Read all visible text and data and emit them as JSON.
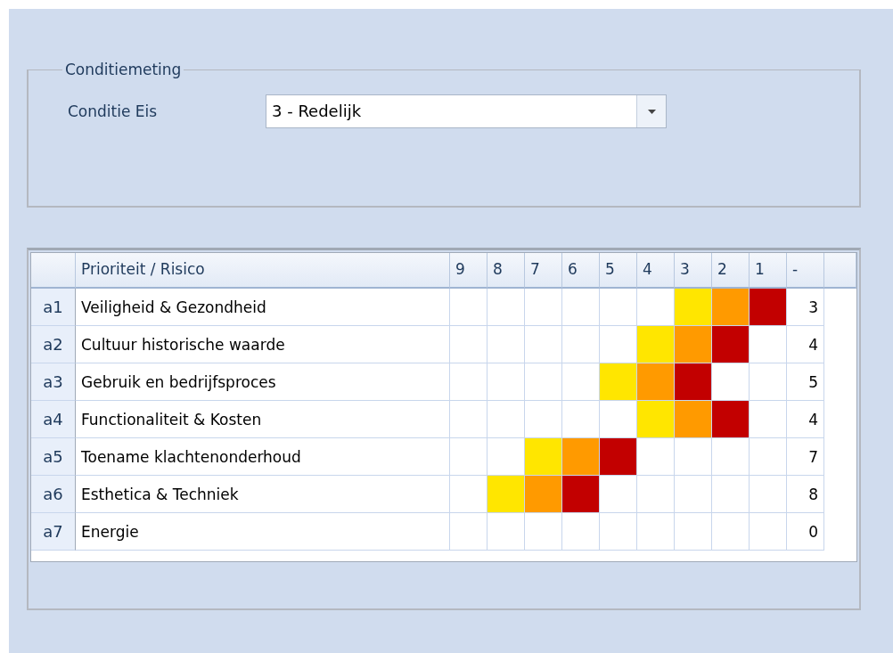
{
  "group": {
    "title": "Conditiemeting",
    "label": "Conditie Eis",
    "dropdown": {
      "value": "3 - Redelijk"
    }
  },
  "table": {
    "columns": [
      "Prioriteit / Risico",
      "9",
      "8",
      "7",
      "6",
      "5",
      "4",
      "3",
      "2",
      "1",
      "-"
    ],
    "rows": [
      {
        "code": "a1",
        "name": "Veiligheid & Gezondheid",
        "cells": [
          {
            "filled": false
          },
          {
            "filled": false
          },
          {
            "filled": false
          },
          {
            "filled": false
          },
          {
            "filled": false
          },
          {
            "filled": false
          },
          {
            "filled": true,
            "color": "#ffe600"
          },
          {
            "filled": true,
            "color": "#ff9a00"
          },
          {
            "filled": true,
            "color": "#c20000"
          }
        ],
        "total": "3"
      },
      {
        "code": "a2",
        "name": "Cultuur historische waarde",
        "cells": [
          {
            "filled": false
          },
          {
            "filled": false
          },
          {
            "filled": false
          },
          {
            "filled": false
          },
          {
            "filled": false
          },
          {
            "filled": true,
            "color": "#ffe600"
          },
          {
            "filled": true,
            "color": "#ff9a00"
          },
          {
            "filled": true,
            "color": "#c20000"
          },
          {
            "filled": false
          }
        ],
        "total": "4"
      },
      {
        "code": "a3",
        "name": "Gebruik en bedrijfsproces",
        "cells": [
          {
            "filled": false
          },
          {
            "filled": false
          },
          {
            "filled": false
          },
          {
            "filled": false
          },
          {
            "filled": true,
            "color": "#ffe600"
          },
          {
            "filled": true,
            "color": "#ff9a00"
          },
          {
            "filled": true,
            "color": "#c20000"
          },
          {
            "filled": false
          },
          {
            "filled": false
          }
        ],
        "total": "5"
      },
      {
        "code": "a4",
        "name": "Functionaliteit & Kosten",
        "cells": [
          {
            "filled": false
          },
          {
            "filled": false
          },
          {
            "filled": false
          },
          {
            "filled": false
          },
          {
            "filled": false
          },
          {
            "filled": true,
            "color": "#ffe600"
          },
          {
            "filled": true,
            "color": "#ff9a00"
          },
          {
            "filled": true,
            "color": "#c20000"
          },
          {
            "filled": false
          }
        ],
        "total": "4"
      },
      {
        "code": "a5",
        "name": "Toename klachtenonderhoud",
        "cells": [
          {
            "filled": false
          },
          {
            "filled": false
          },
          {
            "filled": true,
            "color": "#ffe600"
          },
          {
            "filled": true,
            "color": "#ff9a00"
          },
          {
            "filled": true,
            "color": "#c20000"
          },
          {
            "filled": false
          },
          {
            "filled": false
          },
          {
            "filled": false
          },
          {
            "filled": false
          }
        ],
        "total": "7"
      },
      {
        "code": "a6",
        "name": "Esthetica & Techniek",
        "cells": [
          {
            "filled": false
          },
          {
            "filled": true,
            "color": "#ffe600"
          },
          {
            "filled": true,
            "color": "#ff9a00"
          },
          {
            "filled": true,
            "color": "#c20000"
          },
          {
            "filled": false
          },
          {
            "filled": false
          },
          {
            "filled": false
          },
          {
            "filled": false
          },
          {
            "filled": false
          }
        ],
        "total": "8"
      },
      {
        "code": "a7",
        "name": "Energie",
        "cells": [
          {
            "filled": false
          },
          {
            "filled": false
          },
          {
            "filled": false
          },
          {
            "filled": false
          },
          {
            "filled": false
          },
          {
            "filled": false
          },
          {
            "filled": false
          },
          {
            "filled": false
          },
          {
            "filled": false
          }
        ],
        "total": "0"
      }
    ]
  }
}
